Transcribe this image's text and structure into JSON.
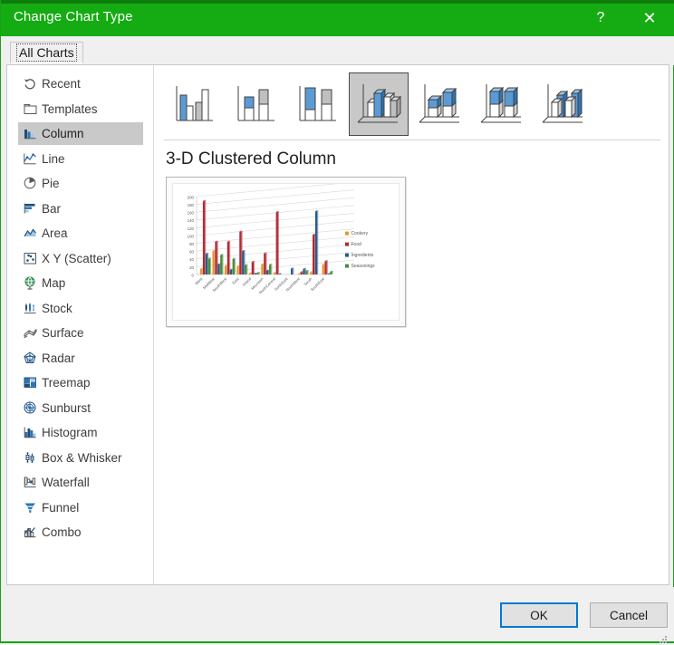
{
  "window": {
    "title": "Change Chart Type",
    "help_glyph": "?",
    "close_glyph": "✕",
    "accent_color": "#15ab13"
  },
  "tabs": [
    {
      "label": "All Charts",
      "selected": true
    }
  ],
  "sidebar": {
    "items": [
      {
        "label": "Recent",
        "icon": "recent-icon",
        "selected": false
      },
      {
        "label": "Templates",
        "icon": "templates-icon",
        "selected": false
      },
      {
        "label": "Column",
        "icon": "column-icon",
        "selected": true
      },
      {
        "label": "Line",
        "icon": "line-icon",
        "selected": false
      },
      {
        "label": "Pie",
        "icon": "pie-icon",
        "selected": false
      },
      {
        "label": "Bar",
        "icon": "bar-icon",
        "selected": false
      },
      {
        "label": "Area",
        "icon": "area-icon",
        "selected": false
      },
      {
        "label": "X Y (Scatter)",
        "icon": "scatter-icon",
        "selected": false
      },
      {
        "label": "Map",
        "icon": "map-icon",
        "selected": false
      },
      {
        "label": "Stock",
        "icon": "stock-icon",
        "selected": false
      },
      {
        "label": "Surface",
        "icon": "surface-icon",
        "selected": false
      },
      {
        "label": "Radar",
        "icon": "radar-icon",
        "selected": false
      },
      {
        "label": "Treemap",
        "icon": "treemap-icon",
        "selected": false
      },
      {
        "label": "Sunburst",
        "icon": "sunburst-icon",
        "selected": false
      },
      {
        "label": "Histogram",
        "icon": "histogram-icon",
        "selected": false
      },
      {
        "label": "Box & Whisker",
        "icon": "box-whisker-icon",
        "selected": false
      },
      {
        "label": "Waterfall",
        "icon": "waterfall-icon",
        "selected": false
      },
      {
        "label": "Funnel",
        "icon": "funnel-icon",
        "selected": false
      },
      {
        "label": "Combo",
        "icon": "combo-icon",
        "selected": false
      }
    ]
  },
  "gallery": {
    "thumbnails": [
      {
        "name": "Clustered Column",
        "selected": false
      },
      {
        "name": "Stacked Column",
        "selected": false
      },
      {
        "name": "100% Stacked Column",
        "selected": false
      },
      {
        "name": "3-D Clustered Column",
        "selected": true
      },
      {
        "name": "3-D Stacked Column",
        "selected": false
      },
      {
        "name": "3-D 100% Stacked Column",
        "selected": false
      },
      {
        "name": "3-D Column",
        "selected": false
      }
    ],
    "preview_title": "3-D Clustered Column"
  },
  "chart_data": {
    "type": "bar",
    "title": "",
    "xlabel": "",
    "ylabel": "",
    "ylim": [
      0,
      200
    ],
    "yticks": [
      0,
      20,
      40,
      60,
      80,
      100,
      120,
      140,
      160,
      180,
      200
    ],
    "grid": true,
    "legend_position": "right",
    "categories": [
      "West",
      "MidWest",
      "SouthWest",
      "East",
      "Inland",
      "Mountain",
      "NorthCentral",
      "NorthEast",
      "NorthWest",
      "South",
      "SouthEast"
    ],
    "series": [
      {
        "name": "Cookery",
        "color": "#E8962F",
        "values": [
          14,
          60,
          22,
          21,
          3,
          26,
          4,
          0,
          1,
          6,
          25
        ]
      },
      {
        "name": "Food",
        "color": "#B02B35",
        "values": [
          188,
          84,
          84,
          110,
          32,
          54,
          160,
          0,
          6,
          102,
          34
        ]
      },
      {
        "name": "Ingredients",
        "color": "#2B5C8A",
        "values": [
          53,
          26,
          12,
          60,
          2,
          10,
          1,
          15,
          14,
          162,
          1
        ]
      },
      {
        "name": "Seasonings",
        "color": "#4B8B3B",
        "values": [
          40,
          50,
          40,
          24,
          4,
          25,
          0,
          0,
          9,
          0,
          7
        ]
      }
    ]
  },
  "footer": {
    "ok_label": "OK",
    "cancel_label": "Cancel"
  }
}
